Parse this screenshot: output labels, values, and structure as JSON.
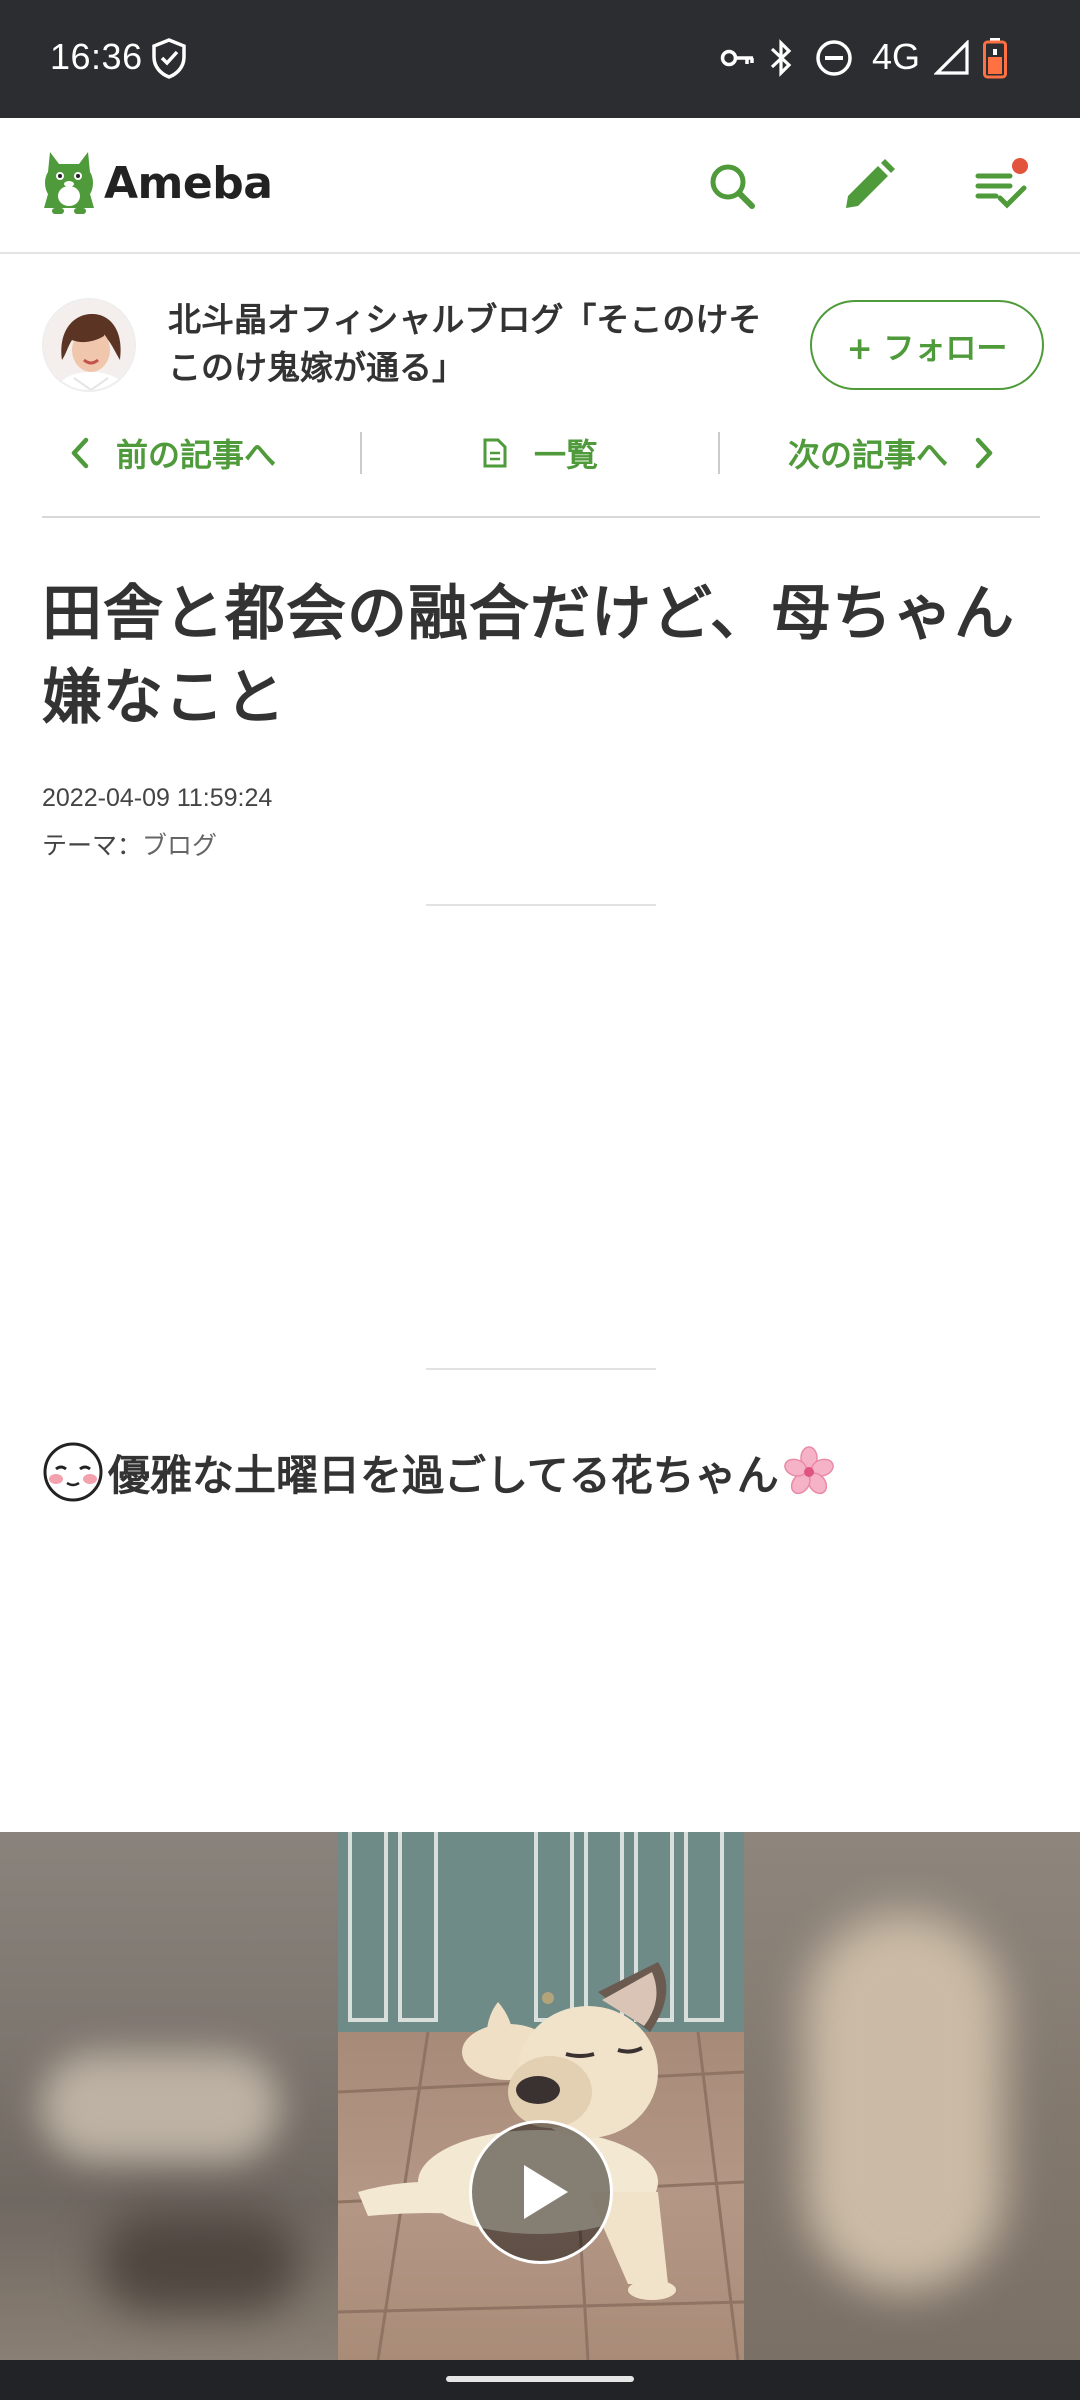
{
  "status_bar": {
    "time": "16:36",
    "network": "4G",
    "icons": [
      "shield-check-icon",
      "vpn-key-icon",
      "bluetooth-icon",
      "do-not-disturb-icon",
      "signal-icon",
      "battery-low-icon"
    ]
  },
  "header": {
    "logo_text": "Ameba",
    "brand_color": "#4f9a3a",
    "icons": [
      "search-icon",
      "pencil-icon",
      "notification-list-icon"
    ]
  },
  "blog": {
    "title": "北斗晶オフィシャルブログ「そこのけそこのけ鬼嫁が通る」",
    "follow_label": "+ フォロー",
    "prev_label": "前の記事へ",
    "list_label": "一覧",
    "next_label": "次の記事へ"
  },
  "article": {
    "title": "田舎と都会の融合だけど、母ちゃん嫌なこと",
    "date": "2022-04-09 11:59:24",
    "theme_prefix": "テーマ：",
    "theme": "ブログ",
    "body_text": "優雅な土曜日を過ごしてる花ちゃん"
  },
  "video": {
    "control": "play-icon"
  }
}
